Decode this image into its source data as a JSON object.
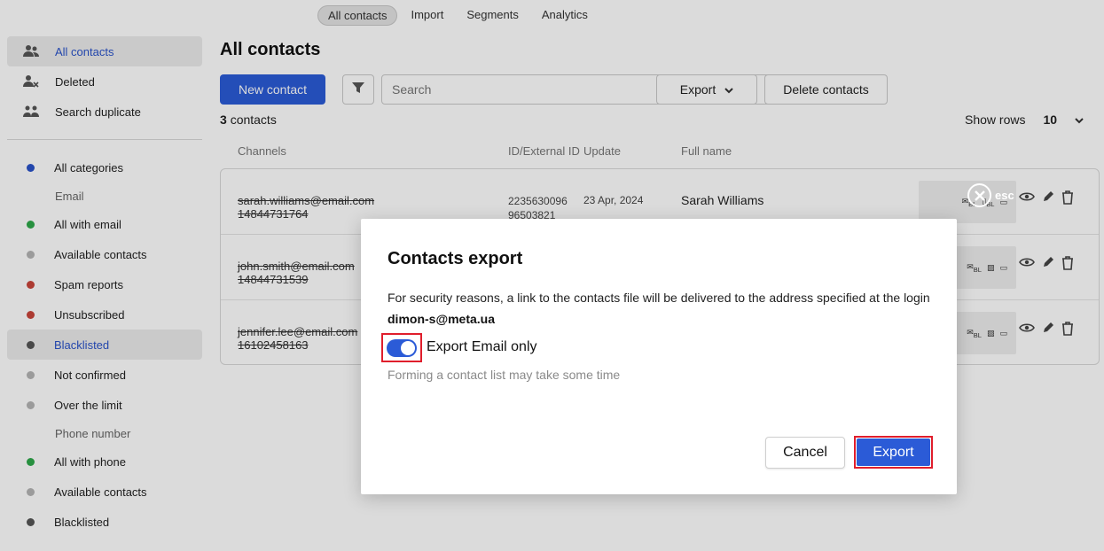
{
  "colors": {
    "accent": "#2b5bd7",
    "highlight": "#e01e2c",
    "dot_blue": "#2952c9",
    "dot_green": "#2ea84a",
    "dot_grey": "#b5b5b5",
    "dot_red": "#c9453b",
    "dot_dark": "#555555"
  },
  "topnav": {
    "tabs": [
      "All contacts",
      "Import",
      "Segments",
      "Analytics"
    ],
    "active": "All contacts"
  },
  "sidebar": {
    "items": [
      {
        "label": "All contacts",
        "icon": "users-icon"
      },
      {
        "label": "Deleted",
        "icon": "user-x-icon"
      },
      {
        "label": "Search duplicate",
        "icon": "duplicate-users-icon"
      }
    ],
    "categories": {
      "label": "All categories"
    },
    "email_section": "Email",
    "email_items": [
      "All with email",
      "Available contacts",
      "Spam reports",
      "Unsubscribed",
      "Blacklisted",
      "Not confirmed",
      "Over the limit"
    ],
    "phone_section": "Phone number",
    "phone_items": [
      "All with phone",
      "Available contacts",
      "Blacklisted"
    ]
  },
  "main": {
    "title": "All contacts",
    "new_contact": "New contact",
    "search_placeholder": "Search",
    "export": "Export",
    "delete_contacts": "Delete contacts",
    "count_num": "3",
    "count_label": "contacts",
    "show_rows_label": "Show rows",
    "show_rows_value": "10",
    "columns": [
      "Channels",
      "ID/External ID",
      "Update",
      "Full name"
    ],
    "rows": [
      {
        "email": "sarah.williams@email.com",
        "phone": "14844731764",
        "id1": "2235630096",
        "id2": "96503821",
        "update": "23 Apr, 2024",
        "name": "Sarah Williams"
      },
      {
        "email": "john.smith@email.com",
        "phone": "14844731539",
        "id1": "",
        "id2": "",
        "update": "",
        "name": ""
      },
      {
        "email": "jennifer.lee@email.com",
        "phone": "16102458163",
        "id1": "",
        "id2": "",
        "update": "",
        "name": ""
      }
    ]
  },
  "esc_label": "esc",
  "modal": {
    "title": "Contacts export",
    "text": "For security reasons, a link to the contacts file will be delivered to the address specified at the login",
    "email": "dimon-s@meta.ua",
    "toggle_label": "Export Email only",
    "toggle_on": true,
    "hint": "Forming a contact list may take some time",
    "cancel": "Cancel",
    "confirm": "Export"
  }
}
